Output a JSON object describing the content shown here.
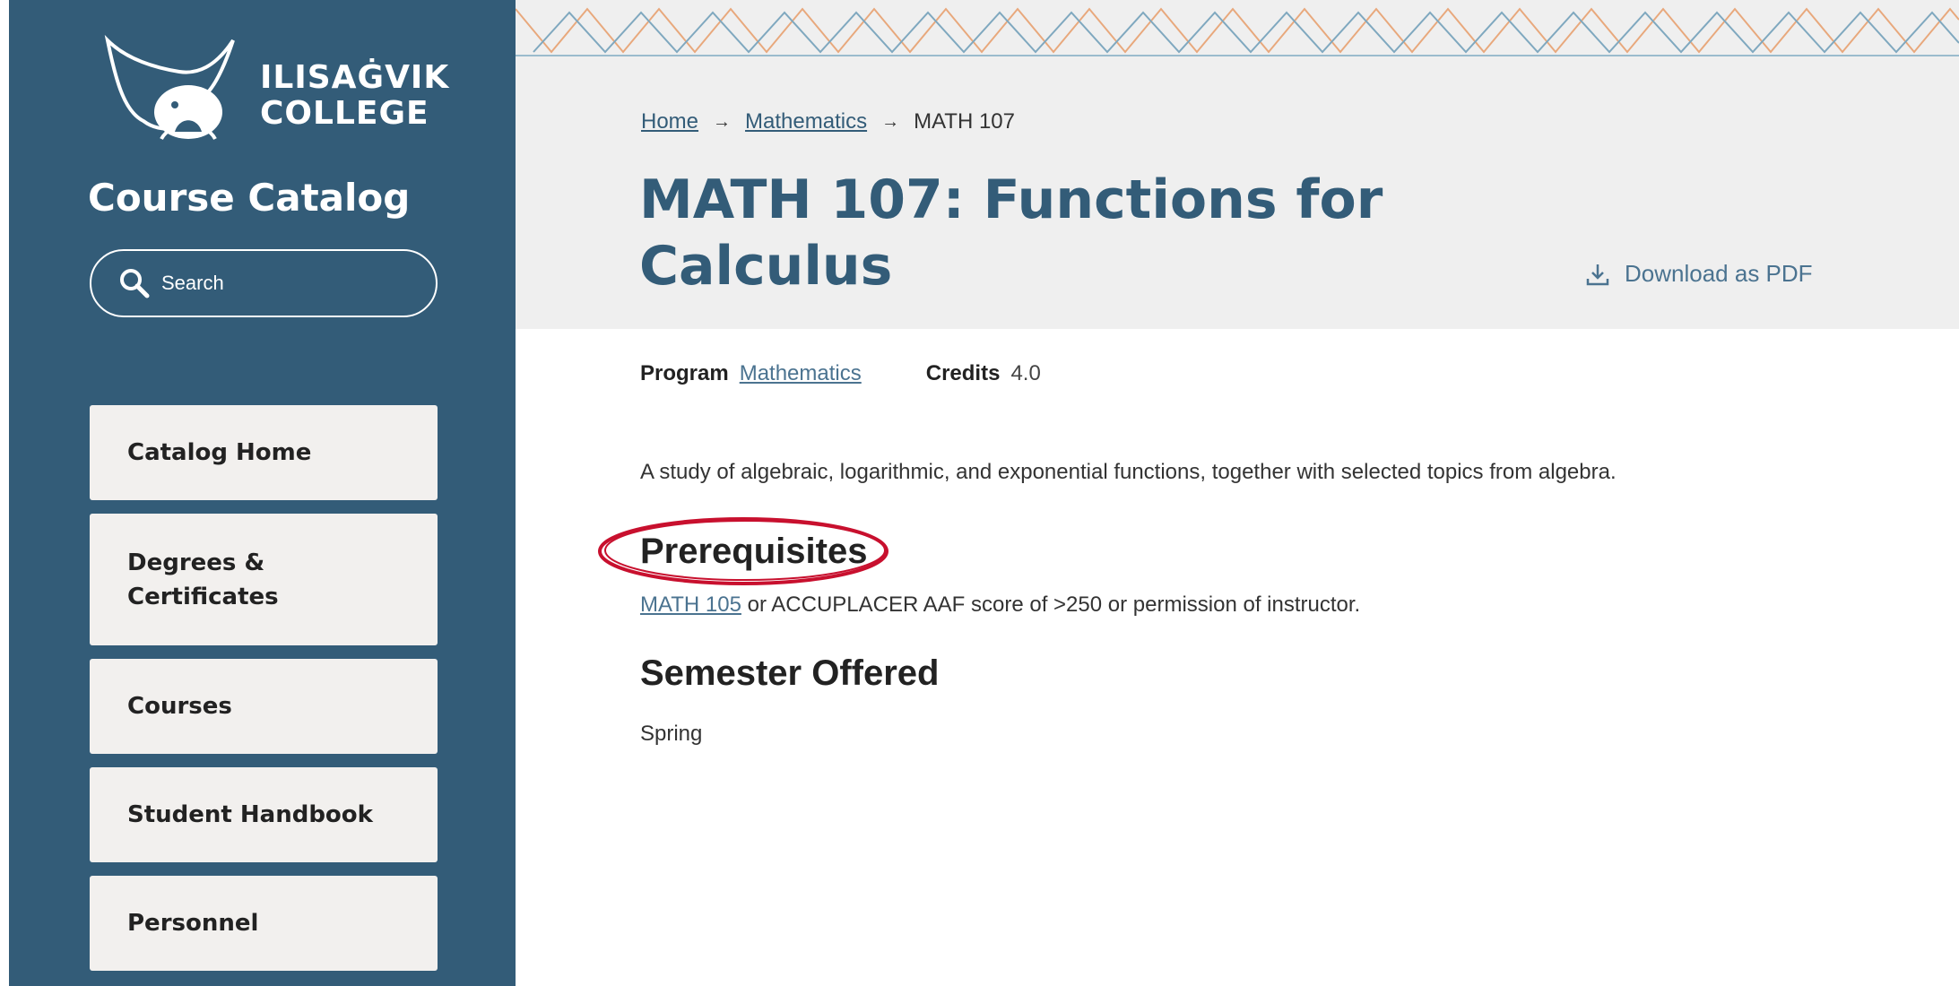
{
  "brand": {
    "line1": "ILISAĠVIK",
    "line2": "COLLEGE",
    "logo_icon": "whale-bear-icon"
  },
  "sidebar": {
    "title": "Course Catalog",
    "search": {
      "placeholder": "Search",
      "icon": "search-icon"
    },
    "items": [
      {
        "label": "Catalog Home"
      },
      {
        "label": "Degrees & Certificates"
      },
      {
        "label": "Courses"
      },
      {
        "label": "Student Handbook"
      },
      {
        "label": "Personnel"
      }
    ]
  },
  "breadcrumb": {
    "home": "Home",
    "program": "Mathematics",
    "current": "MATH 107"
  },
  "course": {
    "title": "MATH 107: Functions for Calculus",
    "download_label": "Download as PDF",
    "program_label": "Program",
    "program_value": "Mathematics",
    "credits_label": "Credits",
    "credits_value": "4.0",
    "description": "A study of algebraic, logarithmic, and exponential functions, together with selected topics from algebra.",
    "prereq_heading": "Prerequisites",
    "prereq_link": "MATH 105",
    "prereq_text": " or ACCUPLACER AAF score of >250 or permission of instructor.",
    "semester_heading": "Semester Offered",
    "semester_value": "Spring"
  },
  "colors": {
    "sidebar_bg": "#335c78",
    "header_bg": "#efefef",
    "title": "#335c78",
    "link": "#4b7390",
    "annotation": "#c8102e",
    "pattern_orange": "#e8a87c",
    "pattern_blue": "#7fa8bf"
  }
}
